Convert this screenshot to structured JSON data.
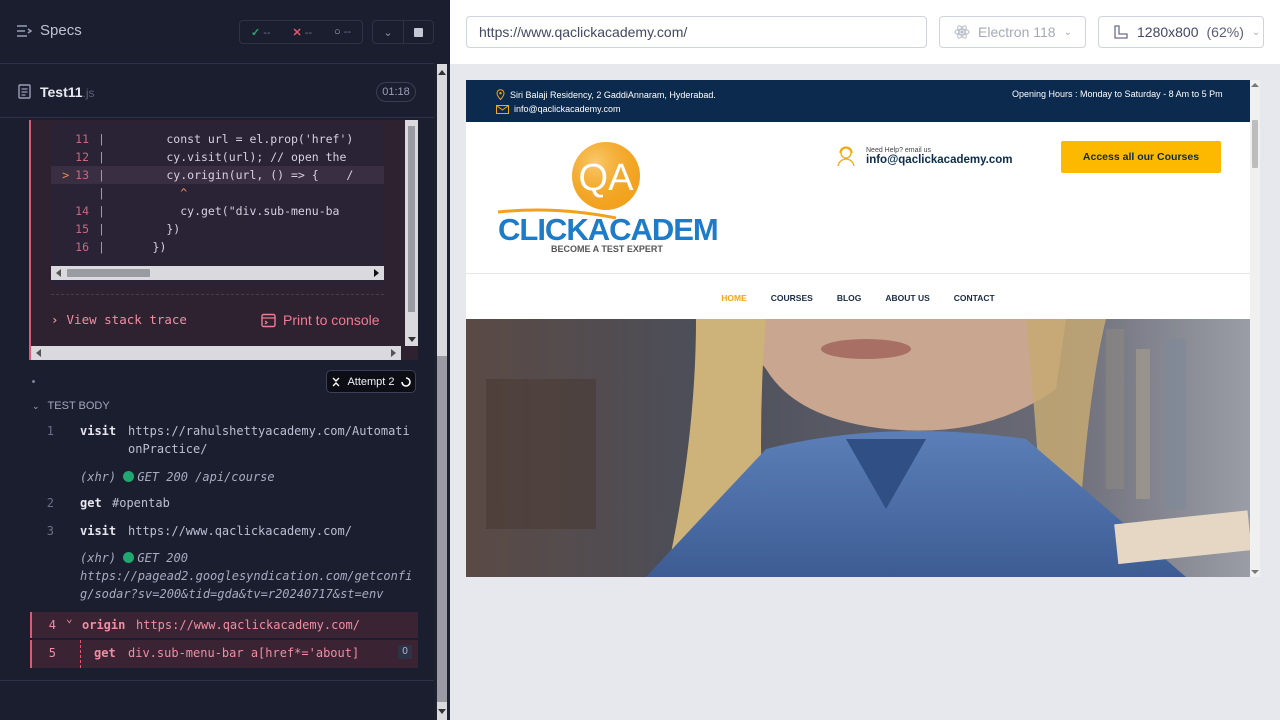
{
  "reporter": {
    "specs_label": "Specs",
    "stats": {
      "passed": "--",
      "failed": "--",
      "pending": "--"
    },
    "file": {
      "name": "Test11",
      "ext": ".js",
      "duration": "01:18"
    },
    "code_frame": [
      {
        "num": "11",
        "code": "        const url = el.prop('href')"
      },
      {
        "num": "12",
        "code": "        cy.visit(url); // open the"
      },
      {
        "num": "13",
        "code": "        cy.origin(url, () => {    /",
        "current": true
      },
      {
        "num": "",
        "code": "          ^"
      },
      {
        "num": "14",
        "code": "          cy.get(\"div.sub-menu-ba"
      },
      {
        "num": "15",
        "code": "        })"
      },
      {
        "num": "16",
        "code": "      })"
      }
    ],
    "view_stack_trace": "View stack trace",
    "print_to_console": "Print to console",
    "attempt": "Attempt 2",
    "test_body": "TEST BODY",
    "commands": [
      {
        "num": "1",
        "name": "visit",
        "msg_lines": [
          "https://rahulshettyacademy.com/Automati",
          "onPractice/"
        ]
      },
      {
        "sub": true,
        "lines": [
          "(xhr)  GET 200 /api/course"
        ]
      },
      {
        "num": "2",
        "name": "get",
        "msg_lines": [
          "#opentab"
        ]
      },
      {
        "num": "3",
        "name": "visit",
        "msg_lines": [
          "https://www.qaclickacademy.com/"
        ]
      },
      {
        "sub": true,
        "lines": [
          "(xhr)  GET 200",
          "https://pagead2.googlesyndication.com/getconfi",
          "g/sodar?sv=200&tid=gda&tv=r20240717&st=env"
        ]
      },
      {
        "num": "4",
        "name": "origin",
        "msg_lines": [
          "https://www.qaclickacademy.com/"
        ],
        "active": true
      },
      {
        "num": "5",
        "name": "get",
        "msg_lines": [
          "div.sub-menu-bar a[href*='about]"
        ],
        "active": true,
        "count": "0"
      }
    ]
  },
  "aut": {
    "url": "https://www.qaclickacademy.com/",
    "browser": "Electron 118",
    "viewport": "1280x800",
    "scale": "(62%)",
    "site": {
      "address": "Siri Balaji Residency, 2 GaddiAnnaram, Hyderabad.",
      "email_top": "info@qaclickacademy.com",
      "hours": "Opening Hours : Monday to Saturday - 8 Am to 5 Pm",
      "logo_qa": "QA",
      "logo_name": "CLICKACADEMY",
      "logo_tagline": "BECOME A TEST EXPERT",
      "help_small": "Need Help? email us",
      "help_email": "info@qaclickacademy.com",
      "access_btn": "Access all our Courses",
      "nav": [
        "HOME",
        "COURSES",
        "BLOG",
        "ABOUT US",
        "CONTACT"
      ]
    }
  },
  "colors": {
    "reporter_bg": "#1b1e2e",
    "error": "#e45770",
    "pass": "#1fa971",
    "site_navy": "#0b2a4d",
    "site_yellow": "#fcb900",
    "logo_orange": "#f2a11c",
    "logo_blue": "#1c7cc9"
  }
}
